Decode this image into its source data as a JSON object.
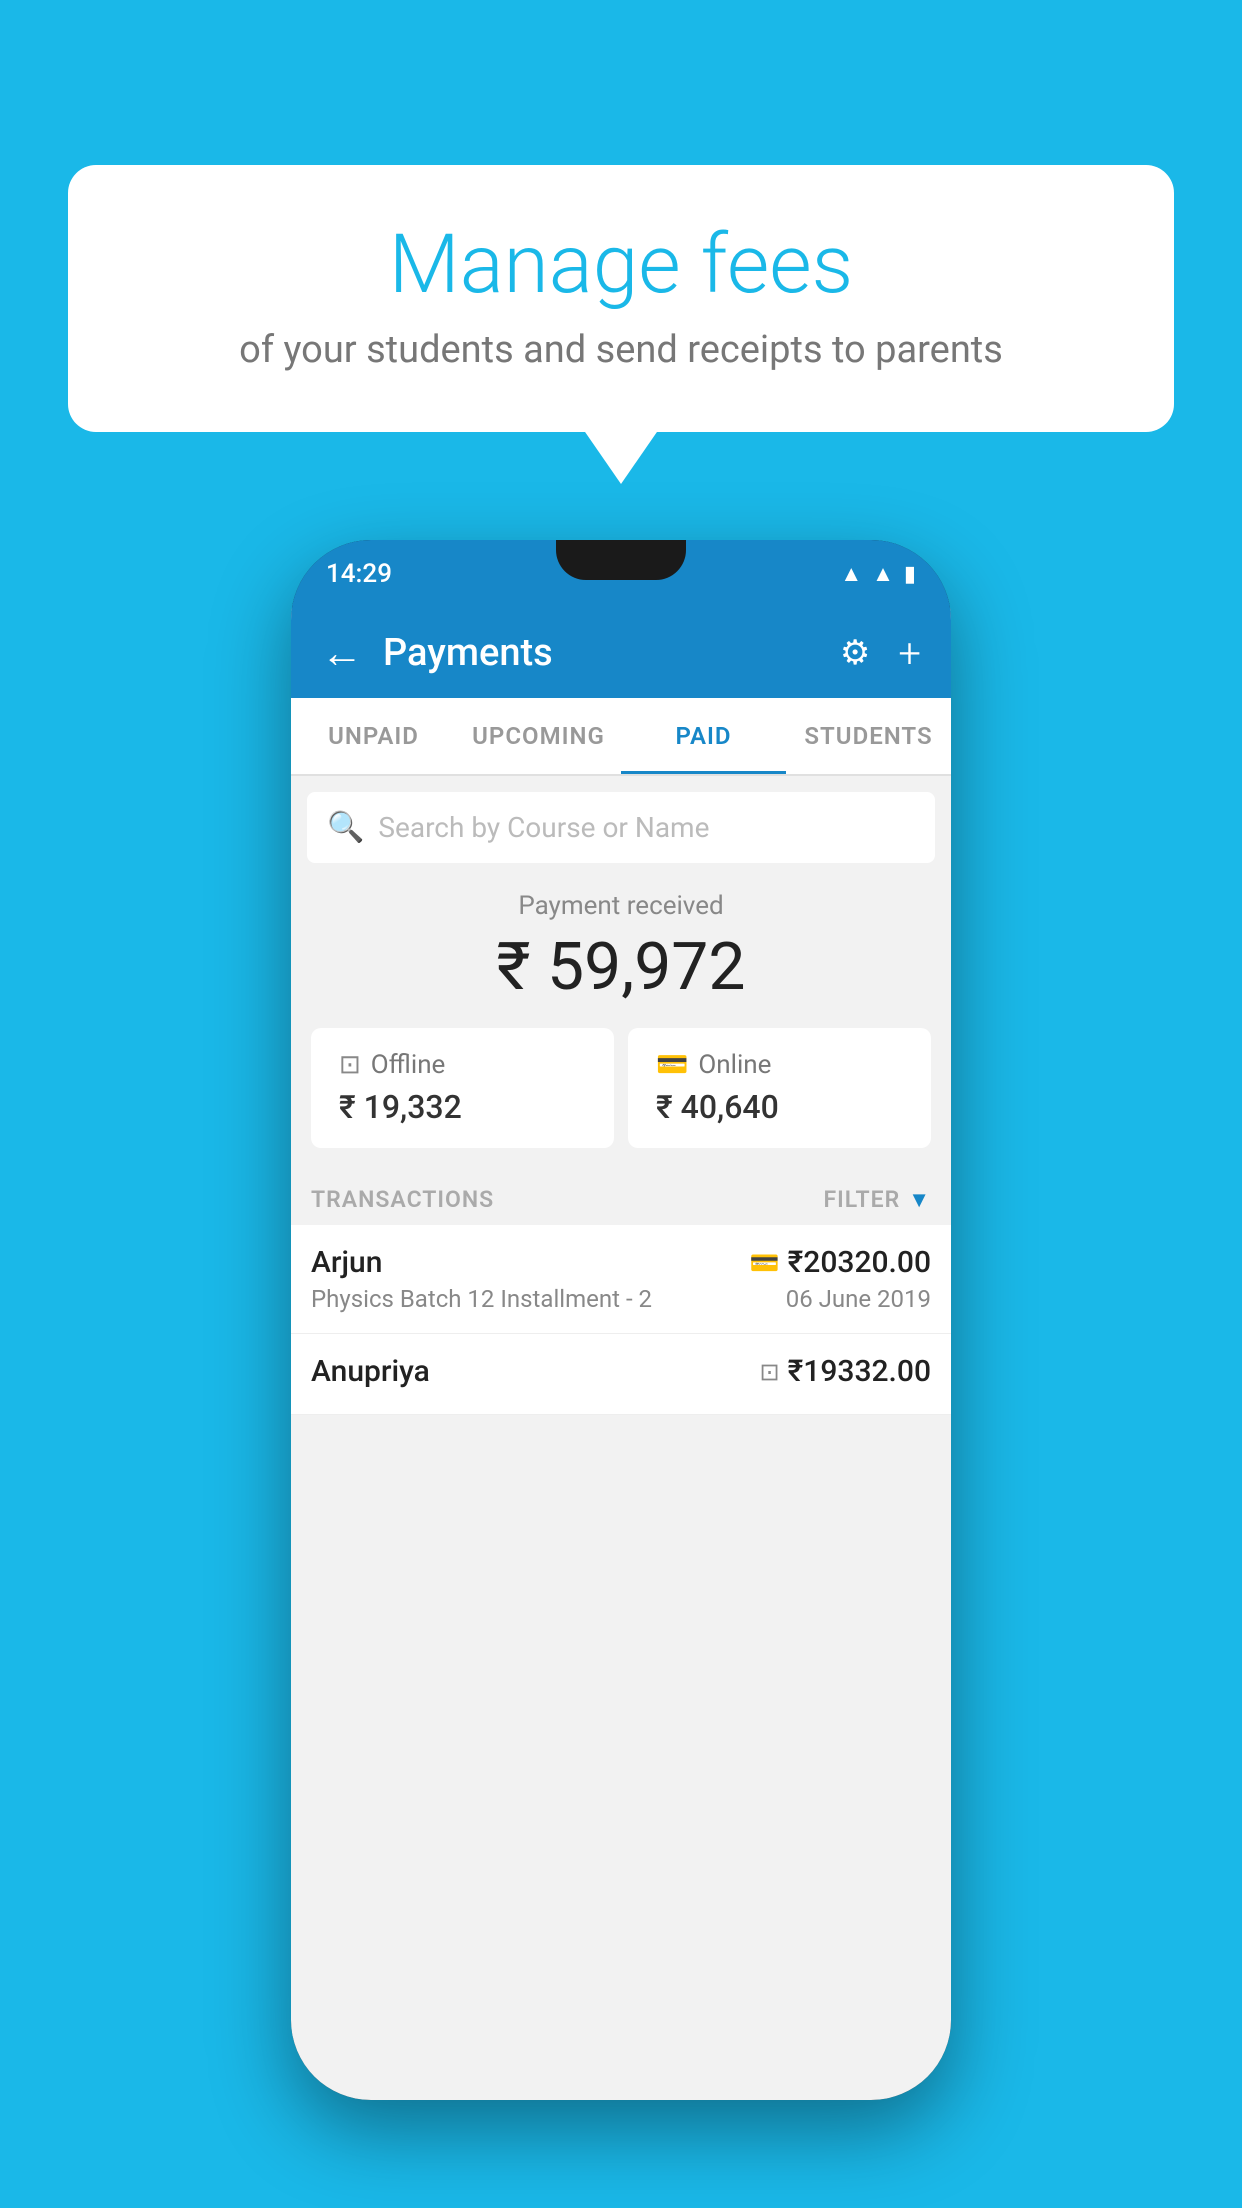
{
  "background_color": "#1ab8e8",
  "speech_bubble": {
    "title": "Manage fees",
    "subtitle": "of your students and send receipts to parents"
  },
  "phone": {
    "status_bar": {
      "time": "14:29",
      "wifi_icon": "wifi",
      "signal_icon": "signal",
      "battery_icon": "battery"
    },
    "app_bar": {
      "back_label": "←",
      "title": "Payments",
      "settings_icon": "gear",
      "add_icon": "+"
    },
    "tabs": [
      {
        "label": "UNPAID",
        "active": false
      },
      {
        "label": "UPCOMING",
        "active": false
      },
      {
        "label": "PAID",
        "active": true
      },
      {
        "label": "STUDENTS",
        "active": false
      }
    ],
    "search": {
      "placeholder": "Search by Course or Name"
    },
    "payment_received": {
      "label": "Payment received",
      "amount": "₹ 59,972",
      "cards": [
        {
          "icon": "rupee-box",
          "type": "Offline",
          "amount": "₹ 19,332"
        },
        {
          "icon": "card",
          "type": "Online",
          "amount": "₹ 40,640"
        }
      ]
    },
    "transactions": {
      "section_label": "TRANSACTIONS",
      "filter_label": "FILTER",
      "items": [
        {
          "name": "Arjun",
          "payment_icon": "card",
          "amount": "₹20320.00",
          "course": "Physics Batch 12 Installment - 2",
          "date": "06 June 2019"
        },
        {
          "name": "Anupriya",
          "payment_icon": "rupee-box",
          "amount": "₹19332.00",
          "course": "",
          "date": ""
        }
      ]
    }
  }
}
